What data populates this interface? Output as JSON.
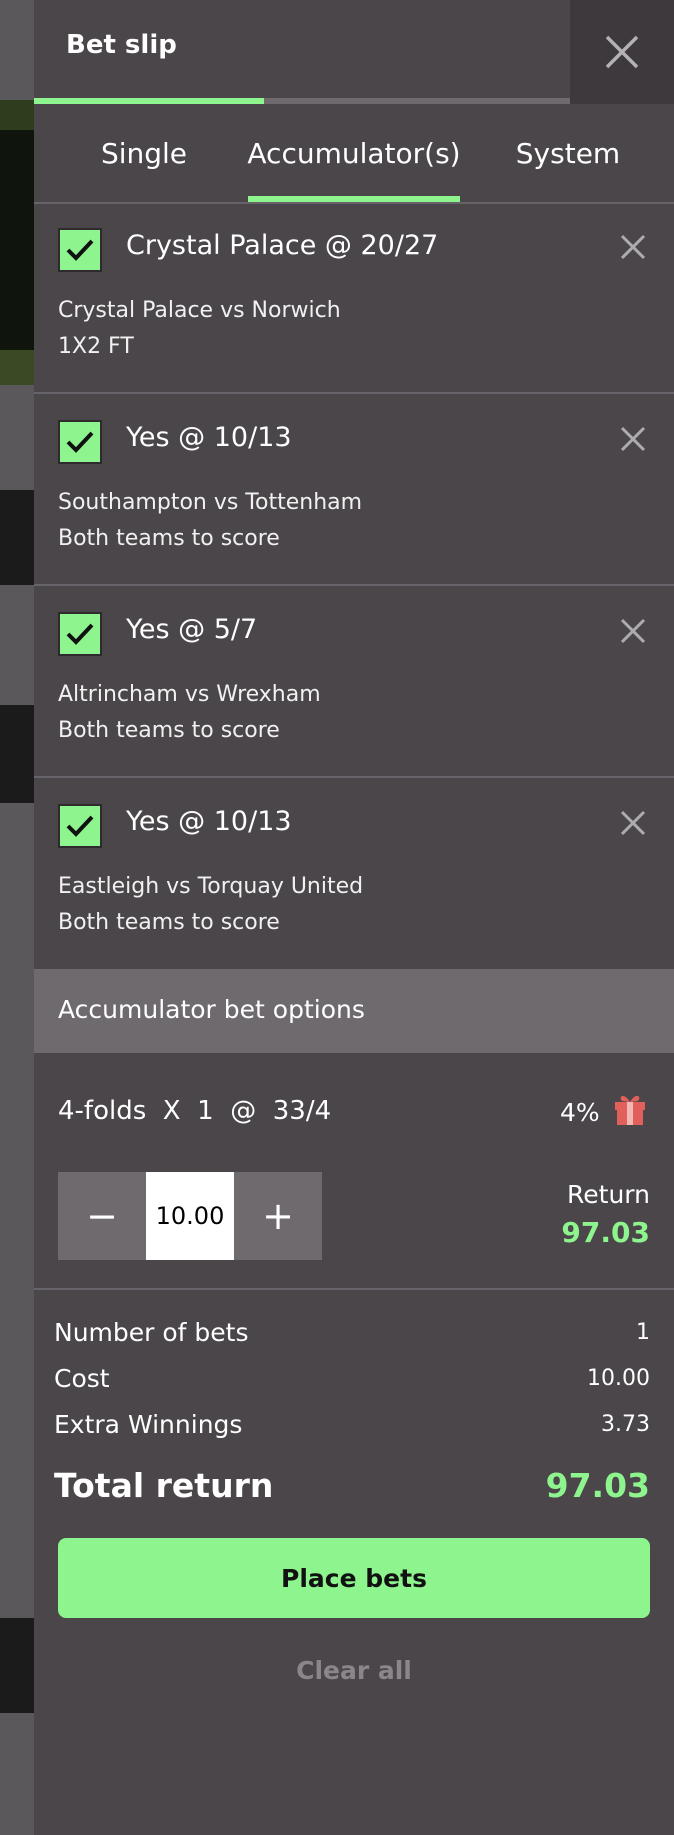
{
  "header": {
    "title": "Bet slip",
    "progress_fraction": 0.43
  },
  "tabs": [
    {
      "label": "Single",
      "active": false
    },
    {
      "label": "Accumulator(s)",
      "active": true
    },
    {
      "label": "System",
      "active": false
    }
  ],
  "selections": [
    {
      "title": "Crystal Palace @ 20/27",
      "event": "Crystal Palace vs Norwich",
      "market": "1X2 FT",
      "checked": true
    },
    {
      "title": "Yes @ 10/13",
      "event": "Southampton vs Tottenham",
      "market": "Both teams to score",
      "checked": true
    },
    {
      "title": "Yes @ 5/7",
      "event": "Altrincham vs Wrexham",
      "market": "Both teams to score",
      "checked": true
    },
    {
      "title": "Yes @ 10/13",
      "event": "Eastleigh vs Torquay United",
      "market": "Both teams to score",
      "checked": true
    }
  ],
  "options": {
    "header": "Accumulator bet options",
    "fold_line": "4-folds  X  1  @  33/4",
    "bonus_pct": "4%",
    "stake": "10.00",
    "minus": "−",
    "plus": "+",
    "return_label": "Return",
    "return_value": "97.03"
  },
  "summary": {
    "number_of_bets_label": "Number of bets",
    "number_of_bets": "1",
    "cost_label": "Cost",
    "cost": "10.00",
    "extra_label": "Extra Winnings",
    "extra": "3.73",
    "total_label": "Total return",
    "total": "97.03"
  },
  "actions": {
    "place": "Place bets",
    "clear": "Clear all"
  },
  "colors": {
    "accent": "#8ef48e",
    "panel": "#4a4649",
    "options_header": "#6e6a6e",
    "gift": "#e2605c"
  }
}
